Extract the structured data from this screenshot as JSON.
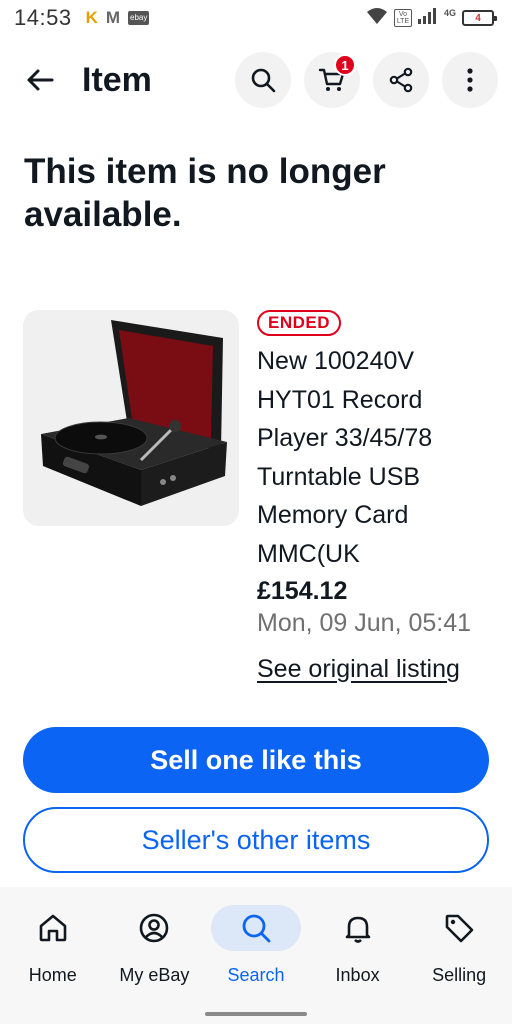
{
  "status_bar": {
    "time": "14:53",
    "app_k": "K",
    "app_m": "M",
    "app_ebay": "ebay",
    "volte": "Vo LTE",
    "network": "4G",
    "battery": "4"
  },
  "header": {
    "title": "Item",
    "cart_count": "1"
  },
  "headline": "This item is no longer available.",
  "item": {
    "status_badge": "ENDED",
    "title": "New 100240V HYT01 Record Player 33/45/78 Turntable USB Memory Card MMC(UK",
    "price": "£154.12",
    "end_date": "Mon, 09 Jun, 05:41",
    "see_original": "See original listing"
  },
  "actions": {
    "sell_label": "Sell one like this",
    "seller_items_label": "Seller's other items"
  },
  "bottom_nav": {
    "items": [
      {
        "label": "Home",
        "icon": "home-icon"
      },
      {
        "label": "My eBay",
        "icon": "account-icon"
      },
      {
        "label": "Search",
        "icon": "search-icon",
        "active": true
      },
      {
        "label": "Inbox",
        "icon": "bell-icon"
      },
      {
        "label": "Selling",
        "icon": "tag-icon"
      }
    ]
  },
  "colors": {
    "primary": "#0b64f4",
    "ended": "#e0001b",
    "nav_active_bg": "#dce8f7"
  }
}
